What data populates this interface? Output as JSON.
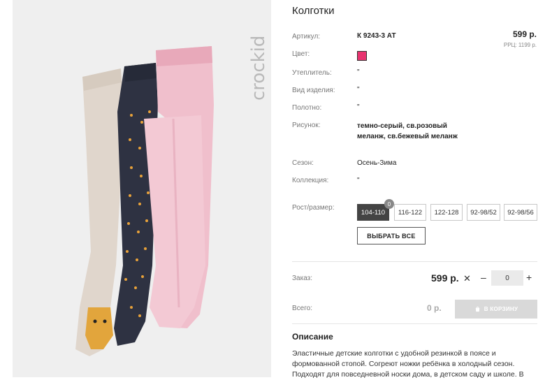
{
  "product": {
    "title": "Колготки",
    "price": "599 р.",
    "rrp": "РРЦ: 1199 р.",
    "brand": "crockid",
    "color_swatch": "#e8336f"
  },
  "specs": [
    {
      "label": "Артикул:",
      "value": "К 9243-3 АТ"
    },
    {
      "label": "Цвет:",
      "value": ""
    },
    {
      "label": "Утеплитель:",
      "value": "\""
    },
    {
      "label": "Вид изделия:",
      "value": "\""
    },
    {
      "label": "Полотно:",
      "value": "\""
    },
    {
      "label": "Рисунок:",
      "value": "темно-серый, св.розовый меланж, св.бежевый меланж"
    },
    {
      "label": "Сезон:",
      "value": "Осень-Зима"
    },
    {
      "label": "Коллекция:",
      "value": "\""
    }
  ],
  "sizes": {
    "label": "Рост/размер:",
    "options": [
      "104-110",
      "116-122",
      "122-128",
      "92-98/52",
      "92-98/56"
    ],
    "selected_count": "0",
    "select_all": "ВЫБРАТЬ ВСЕ"
  },
  "order": {
    "label": "Заказ:",
    "price": "599 р.",
    "quantity": "0",
    "total_label": "Всего:",
    "total": "0 р.",
    "cart_button": "В КОРЗИНУ"
  },
  "description": {
    "title": "Описание",
    "text": "Эластичные детские колготки с удобной резинкой в поясе и формованной стопой. Согреют ножки ребёнка в холодный сезон. Подходят для повседневной носки дома, в детском саду и школе. В"
  }
}
